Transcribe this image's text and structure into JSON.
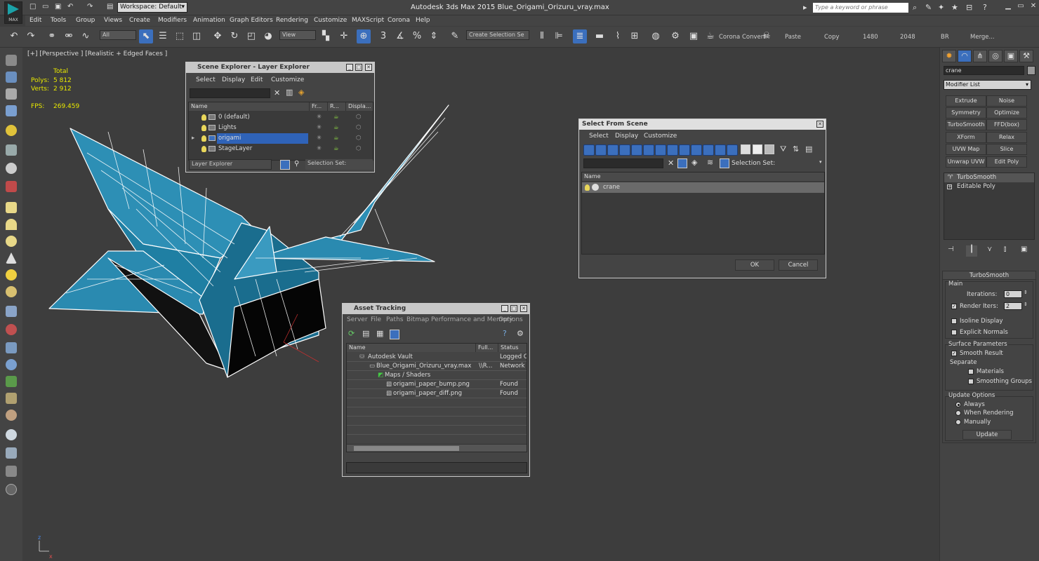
{
  "app": {
    "logo_label": "MAX",
    "title": "Autodesk 3ds Max  2015    Blue_Origami_Orizuru_vray.max",
    "workspace": "Workspace: Default",
    "help_search_placeholder": "Type a keyword or phrase"
  },
  "menu": [
    "Edit",
    "Tools",
    "Group",
    "Views",
    "Create",
    "Modifiers",
    "Animation",
    "Graph Editors",
    "Rendering",
    "Customize",
    "MAXScript",
    "Corona",
    "Help"
  ],
  "toolbar": {
    "filter_select": "All",
    "view_select": "View",
    "selection_set": "Create Selection Se",
    "text_items": [
      "Corona Convert",
      "Paste",
      "Copy",
      "1480",
      "2048",
      "BR",
      "Merge..."
    ]
  },
  "viewport": {
    "label": "[+] [Perspective ] [Realistic + Edged Faces ]",
    "stats": {
      "total_label": "Total",
      "polys_label": "Polys:",
      "polys_value": "5 812",
      "verts_label": "Verts:",
      "verts_value": "2 912",
      "fps_label": "FPS:",
      "fps_value": "269.459"
    },
    "axis_labels": [
      "z",
      "x"
    ],
    "colors": {
      "background": "#3d3d3d",
      "model": "#1f7fa3",
      "wire": "#ffffff"
    }
  },
  "command_panel": {
    "object_name": "crane",
    "modifier_list": "Modifier List",
    "modifier_buttons": [
      "Extrude",
      "Noise",
      "Symmetry",
      "Optimize",
      "TurboSmooth",
      "FFD(box)",
      "XForm",
      "Relax",
      "UVW Map",
      "Slice",
      "Unwrap UVW",
      "Edit Poly"
    ],
    "stack": [
      "TurboSmooth",
      "Editable Poly"
    ],
    "turbosmooth": {
      "title": "TurboSmooth",
      "main_label": "Main",
      "iterations_label": "Iterations:",
      "iterations_value": "0",
      "render_iters_label": "Render Iters:",
      "render_iters_value": "2",
      "isoline_label": "Isoline Display",
      "explicit_label": "Explicit Normals",
      "surface_label": "Surface Parameters",
      "smooth_result_label": "Smooth Result",
      "separate_label": "Separate",
      "materials_label": "Materials",
      "smoothing_groups_label": "Smoothing Groups",
      "update_options_label": "Update Options",
      "always_label": "Always",
      "when_rendering_label": "When Rendering",
      "manually_label": "Manually",
      "update_button": "Update"
    }
  },
  "scene_explorer": {
    "title": "Scene Explorer - Layer Explorer",
    "menu": [
      "Select",
      "Display",
      "Edit",
      "Customize"
    ],
    "columns": [
      "Name",
      "Fr...",
      "R...",
      "Displa..."
    ],
    "rows": [
      "0 (default)",
      "Lights",
      "origami",
      "StageLayer"
    ],
    "selected_row": "origami",
    "footer_select": "Layer Explorer",
    "footer_selection_set": "Selection Set:"
  },
  "select_from_scene": {
    "title": "Select From Scene",
    "menu": [
      "Select",
      "Display",
      "Customize"
    ],
    "selection_set": "Selection Set:",
    "column": "Name",
    "rows": [
      "crane"
    ],
    "ok": "OK",
    "cancel": "Cancel"
  },
  "asset_tracking": {
    "title": "Asset Tracking",
    "menu": [
      "Server",
      "File",
      "Paths",
      "Bitmap Performance and Memory",
      "Options"
    ],
    "columns": [
      "Name",
      "Full...",
      "Status"
    ],
    "rows": [
      {
        "name": "Autodesk Vault",
        "full": "",
        "status": "Logged Ou"
      },
      {
        "name": "Blue_Origami_Orizuru_vray.max",
        "full": "\\\\R...",
        "status": "Network P"
      },
      {
        "name": "Maps / Shaders",
        "full": "",
        "status": ""
      },
      {
        "name": "origami_paper_bump.png",
        "full": "",
        "status": "Found"
      },
      {
        "name": "origami_paper_diff.png",
        "full": "",
        "status": "Found"
      }
    ]
  }
}
